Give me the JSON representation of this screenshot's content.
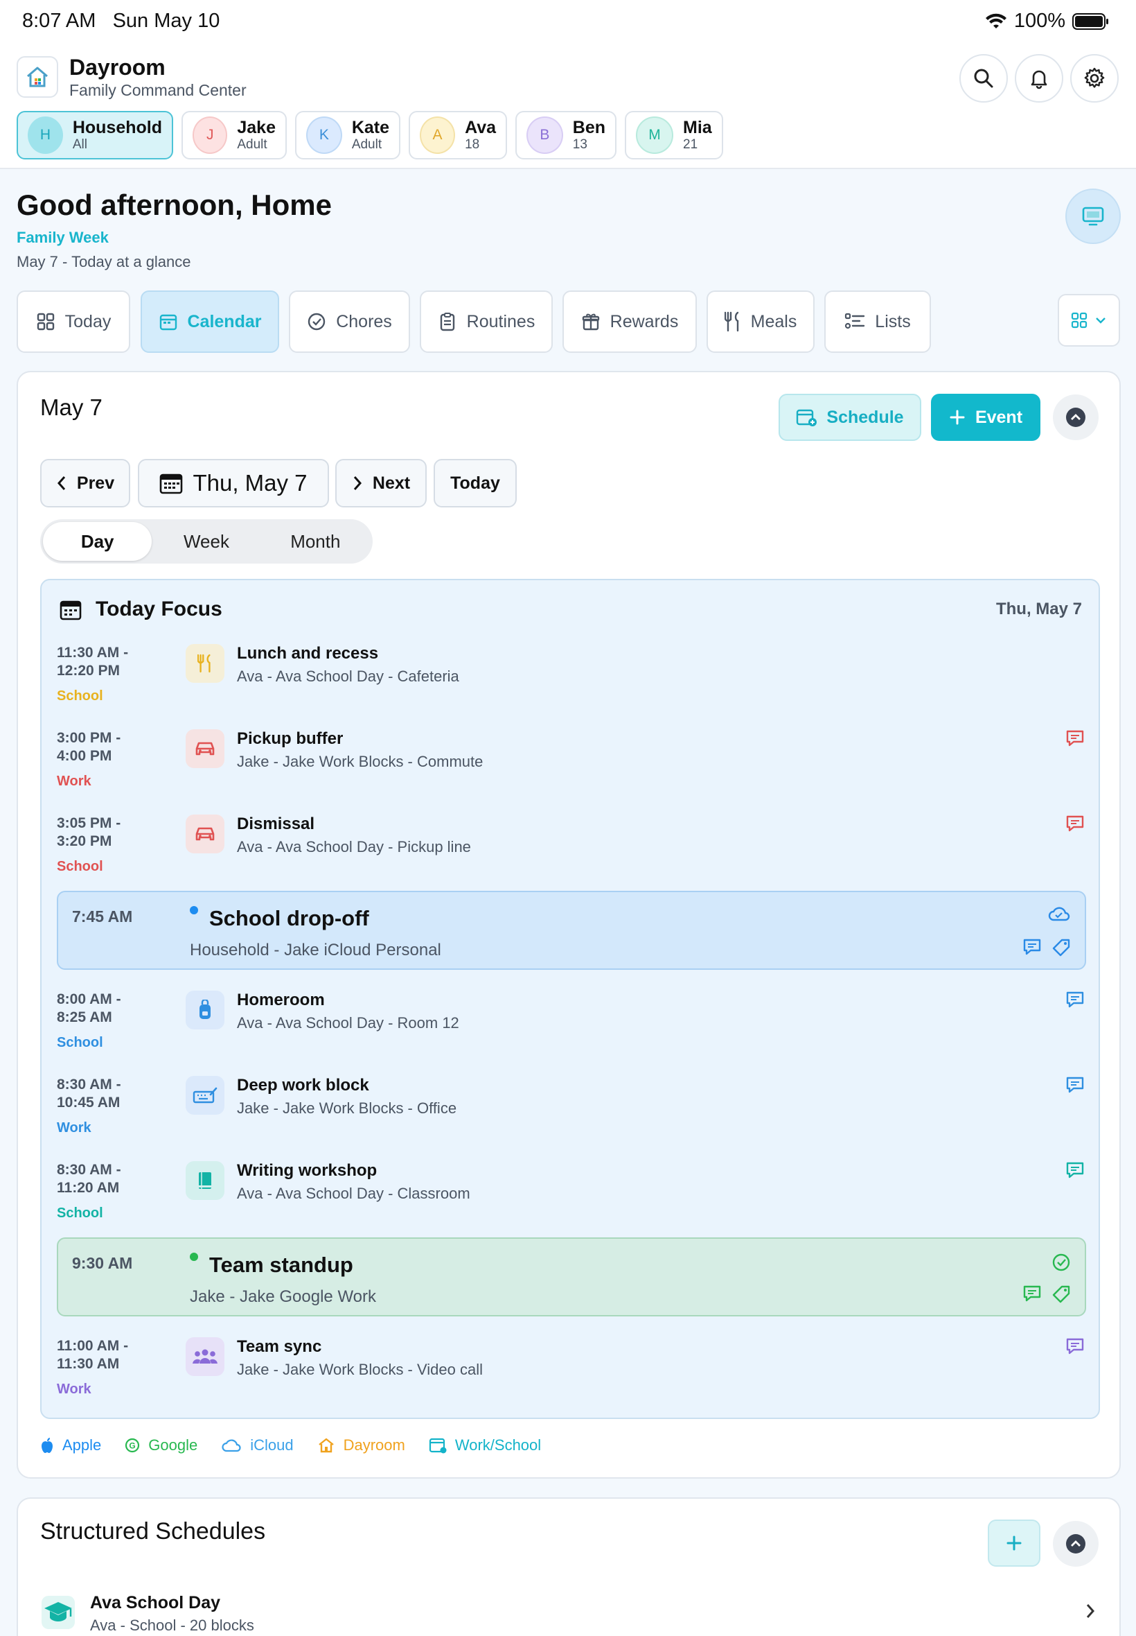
{
  "status_bar": {
    "time": "8:07 AM",
    "date": "Sun May 10",
    "battery": "100%"
  },
  "app": {
    "title": "Dayroom",
    "subtitle": "Family Command Center"
  },
  "members": [
    {
      "initial": "H",
      "name": "Household",
      "role": "All",
      "color": "#9fe3ec",
      "text": "#1aa6bb"
    },
    {
      "initial": "J",
      "name": "Jake",
      "role": "Adult",
      "color": "#fde2e2",
      "text": "#e05a5a"
    },
    {
      "initial": "K",
      "name": "Kate",
      "role": "Adult",
      "color": "#dbeafe",
      "text": "#3b8fd8"
    },
    {
      "initial": "A",
      "name": "Ava",
      "role": "18",
      "color": "#fdf3d0",
      "text": "#e0a72a"
    },
    {
      "initial": "B",
      "name": "Ben",
      "role": "13",
      "color": "#ebe4fb",
      "text": "#8b6fd6"
    },
    {
      "initial": "M",
      "name": "Mia",
      "role": "21",
      "color": "#d8f5ef",
      "text": "#1eb59a"
    }
  ],
  "greeting": {
    "title": "Good afternoon, Home",
    "week": "Family Week",
    "glance": "May 7 - Today at a glance"
  },
  "tabs": [
    "Today",
    "Calendar",
    "Chores",
    "Routines",
    "Rewards",
    "Meals",
    "Lists"
  ],
  "calendar": {
    "title": "May 7",
    "schedule_label": "Schedule",
    "event_label": "Event",
    "prev": "Prev",
    "current_date": "Thu, May 7",
    "next": "Next",
    "today": "Today",
    "views": [
      "Day",
      "Week",
      "Month"
    ],
    "selected_view": "Day",
    "focus_title": "Today Focus",
    "focus_date": "Thu, May 7",
    "items": [
      {
        "time1": "11:30 AM -",
        "time2": "12:20 PM",
        "cat": "School",
        "catColor": "#e8b21f",
        "title": "Lunch and recess",
        "sub": "Ava - Ava School Day - Cafeteria",
        "icon": "fork-knife-icon",
        "iconBg": "#f5efd8",
        "iconColor": "#e8b21f",
        "comment": ""
      },
      {
        "time1": "3:00 PM -",
        "time2": "4:00 PM",
        "cat": "Work",
        "catColor": "#e05252",
        "title": "Pickup buffer",
        "sub": "Jake - Jake Work Blocks - Commute",
        "icon": "car-icon",
        "iconBg": "#f6e3e3",
        "iconColor": "#e05252",
        "comment": "#e05252"
      },
      {
        "time1": "3:05 PM -",
        "time2": "3:20 PM",
        "cat": "School",
        "catColor": "#e05252",
        "title": "Dismissal",
        "sub": "Ava - Ava School Day - Pickup line",
        "icon": "car-icon",
        "iconBg": "#f6e3e3",
        "iconColor": "#e05252",
        "comment": "#e05252"
      }
    ],
    "highlight1": {
      "time": "7:45 AM",
      "title": "School drop-off",
      "sub": "Household - Jake iCloud Personal",
      "dot": "#1d8cf0",
      "bg": "#d3e8fb",
      "border": "#a9d0f3",
      "iconColor": "#2a8ae6"
    },
    "items2": [
      {
        "time1": "8:00 AM -",
        "time2": "8:25 AM",
        "cat": "School",
        "catColor": "#2f8fe0",
        "title": "Homeroom",
        "sub": "Ava - Ava School Day - Room 12",
        "icon": "backpack-icon",
        "iconBg": "#dbe9fb",
        "iconColor": "#2f8fe0",
        "comment": "#2f8fe0"
      },
      {
        "time1": "8:30 AM -",
        "time2": "10:45 AM",
        "cat": "Work",
        "catColor": "#2f8fe0",
        "title": "Deep work block",
        "sub": "Jake - Jake Work Blocks - Office",
        "icon": "keyboard-icon",
        "iconBg": "#dbe9fb",
        "iconColor": "#2f8fe0",
        "comment": "#2f8fe0"
      },
      {
        "time1": "8:30 AM -",
        "time2": "11:20 AM",
        "cat": "School",
        "catColor": "#13b3a5",
        "title": "Writing workshop",
        "sub": "Ava - Ava School Day - Classroom",
        "icon": "book-icon",
        "iconBg": "#d4f0ee",
        "iconColor": "#13b3a5",
        "comment": "#13b3a5"
      }
    ],
    "highlight2": {
      "time": "9:30 AM",
      "title": "Team standup",
      "sub": "Jake - Jake Google Work",
      "dot": "#28b850",
      "bg": "#d6ede4",
      "border": "#a8d8bd",
      "iconColor": "#28b850"
    },
    "items3": [
      {
        "time1": "11:00 AM -",
        "time2": "11:30 AM",
        "cat": "Work",
        "catColor": "#8a6bd8",
        "title": "Team sync",
        "sub": "Jake - Jake Work Blocks - Video call",
        "icon": "people-icon",
        "iconBg": "#e7e1f8",
        "iconColor": "#8a6bd8",
        "comment": "#8a6bd8"
      }
    ],
    "legend": [
      {
        "label": "Apple",
        "color": "#1d8cf0",
        "icon": "apple-icon"
      },
      {
        "label": "Google",
        "color": "#28b850",
        "icon": "google-icon"
      },
      {
        "label": "iCloud",
        "color": "#3aa0e8",
        "icon": "cloud-icon"
      },
      {
        "label": "Dayroom",
        "color": "#f0a21e",
        "icon": "house-icon"
      },
      {
        "label": "Work/School",
        "color": "#13b3c9",
        "icon": "calendar-icon"
      }
    ]
  },
  "structured": {
    "title": "Structured Schedules",
    "items": [
      {
        "name": "Ava School Day",
        "sub": "Ava - School - 20 blocks",
        "icon": "graduation-cap-icon"
      }
    ]
  }
}
